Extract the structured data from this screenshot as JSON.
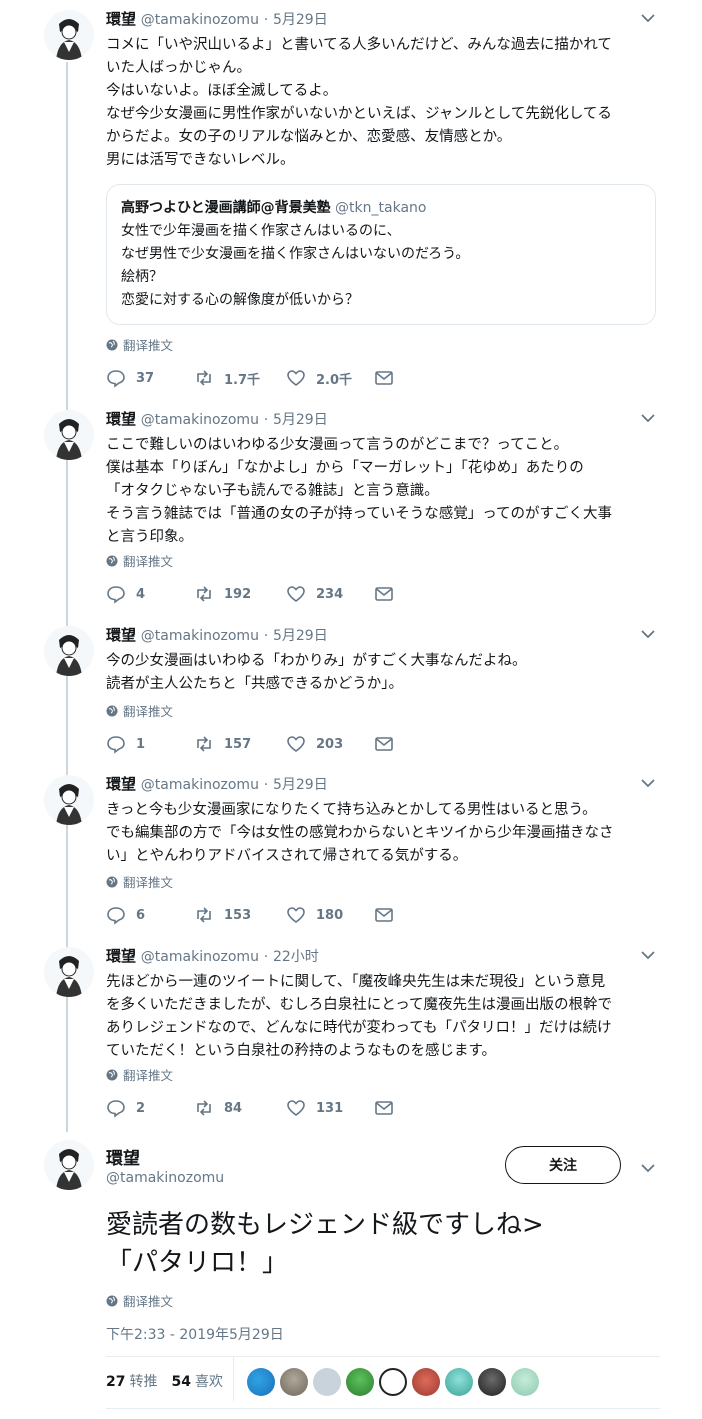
{
  "user": {
    "name": "環望",
    "handle": "@tamakinozomu"
  },
  "translate_label": "翻译推文",
  "tweets": [
    {
      "time": "5月29日",
      "lines": [
        "コメに「いや沢山いるよ」と書いてる人多いんだけど、みんな過去に描かれて",
        "いた人ばっかじゃん。",
        "今はいないよ。ほぼ全滅してるよ。",
        "なぜ今少女漫画に男性作家がいないかといえば、ジャンルとして先鋭化してる",
        "からだよ。女の子のリアルな悩みとか、恋愛感、友情感とか。",
        "男には活写できないレベル。"
      ],
      "quote": {
        "name": "高野つよひと漫画講師@背景美塾",
        "handle": "@tkn_takano",
        "lines": [
          "女性で少年漫画を描く作家さんはいるのに、",
          "なぜ男性で少女漫画を描く作家さんはいないのだろう。",
          "絵柄？",
          "恋愛に対する心の解像度が低いから？"
        ]
      },
      "replies": "37",
      "retweets": "1.7千",
      "likes": "2.0千"
    },
    {
      "time": "5月29日",
      "lines": [
        "ここで難しいのはいわゆる少女漫画って言うのがどこまで？ってこと。",
        "僕は基本「りぼん」「なかよし」から「マーガレット」「花ゆめ」あたりの",
        "「オタクじゃない子も読んでる雑誌」と言う意識。",
        "そう言う雑誌では「普通の女の子が持っていそうな感覚」ってのがすごく大事",
        "と言う印象。"
      ],
      "replies": "4",
      "retweets": "192",
      "likes": "234"
    },
    {
      "time": "5月29日",
      "lines": [
        "今の少女漫画はいわゆる「わかりみ」がすごく大事なんだよね。",
        "読者が主人公たちと「共感できるかどうか」。"
      ],
      "replies": "1",
      "retweets": "157",
      "likes": "203"
    },
    {
      "time": "5月29日",
      "lines": [
        "きっと今も少女漫画家になりたくて持ち込みとかしてる男性はいると思う。",
        "でも編集部の方で「今は女性の感覚わからないとキツイから少年漫画描きなさ",
        "い」とやんわりアドバイスされて帰されてる気がする。"
      ],
      "replies": "6",
      "retweets": "153",
      "likes": "180"
    },
    {
      "time": "22小时",
      "lines": [
        "先ほどから一連のツイートに関して、「魔夜峰央先生は未だ現役」という意見",
        "を多くいただきましたが、むしろ白泉社にとって魔夜先生は漫画出版の根幹で",
        "ありレジェンドなので、どんなに時代が変わっても「パタリロ！」だけは続け",
        "ていただく！という白泉社の矜持のようなものを感じます。"
      ],
      "replies": "2",
      "retweets": "84",
      "likes": "131"
    }
  ],
  "main_tweet": {
    "follow_label": "关注",
    "lines": [
      "愛読者の数もレジェンド級ですしね>",
      "「パタリロ！」"
    ],
    "timestamp": "下午2:33 - 2019年5月29日",
    "retweet_count": "27",
    "retweet_label": "转推",
    "like_count": "54",
    "like_label": "喜欢"
  },
  "colors": {
    "secondary_text": "#657786",
    "border": "#e1e8ed",
    "thread_line": "#ccd6dd"
  },
  "icons": [
    "chevron-down-icon",
    "globe-icon",
    "reply-icon",
    "retweet-icon",
    "heart-icon",
    "mail-icon"
  ]
}
